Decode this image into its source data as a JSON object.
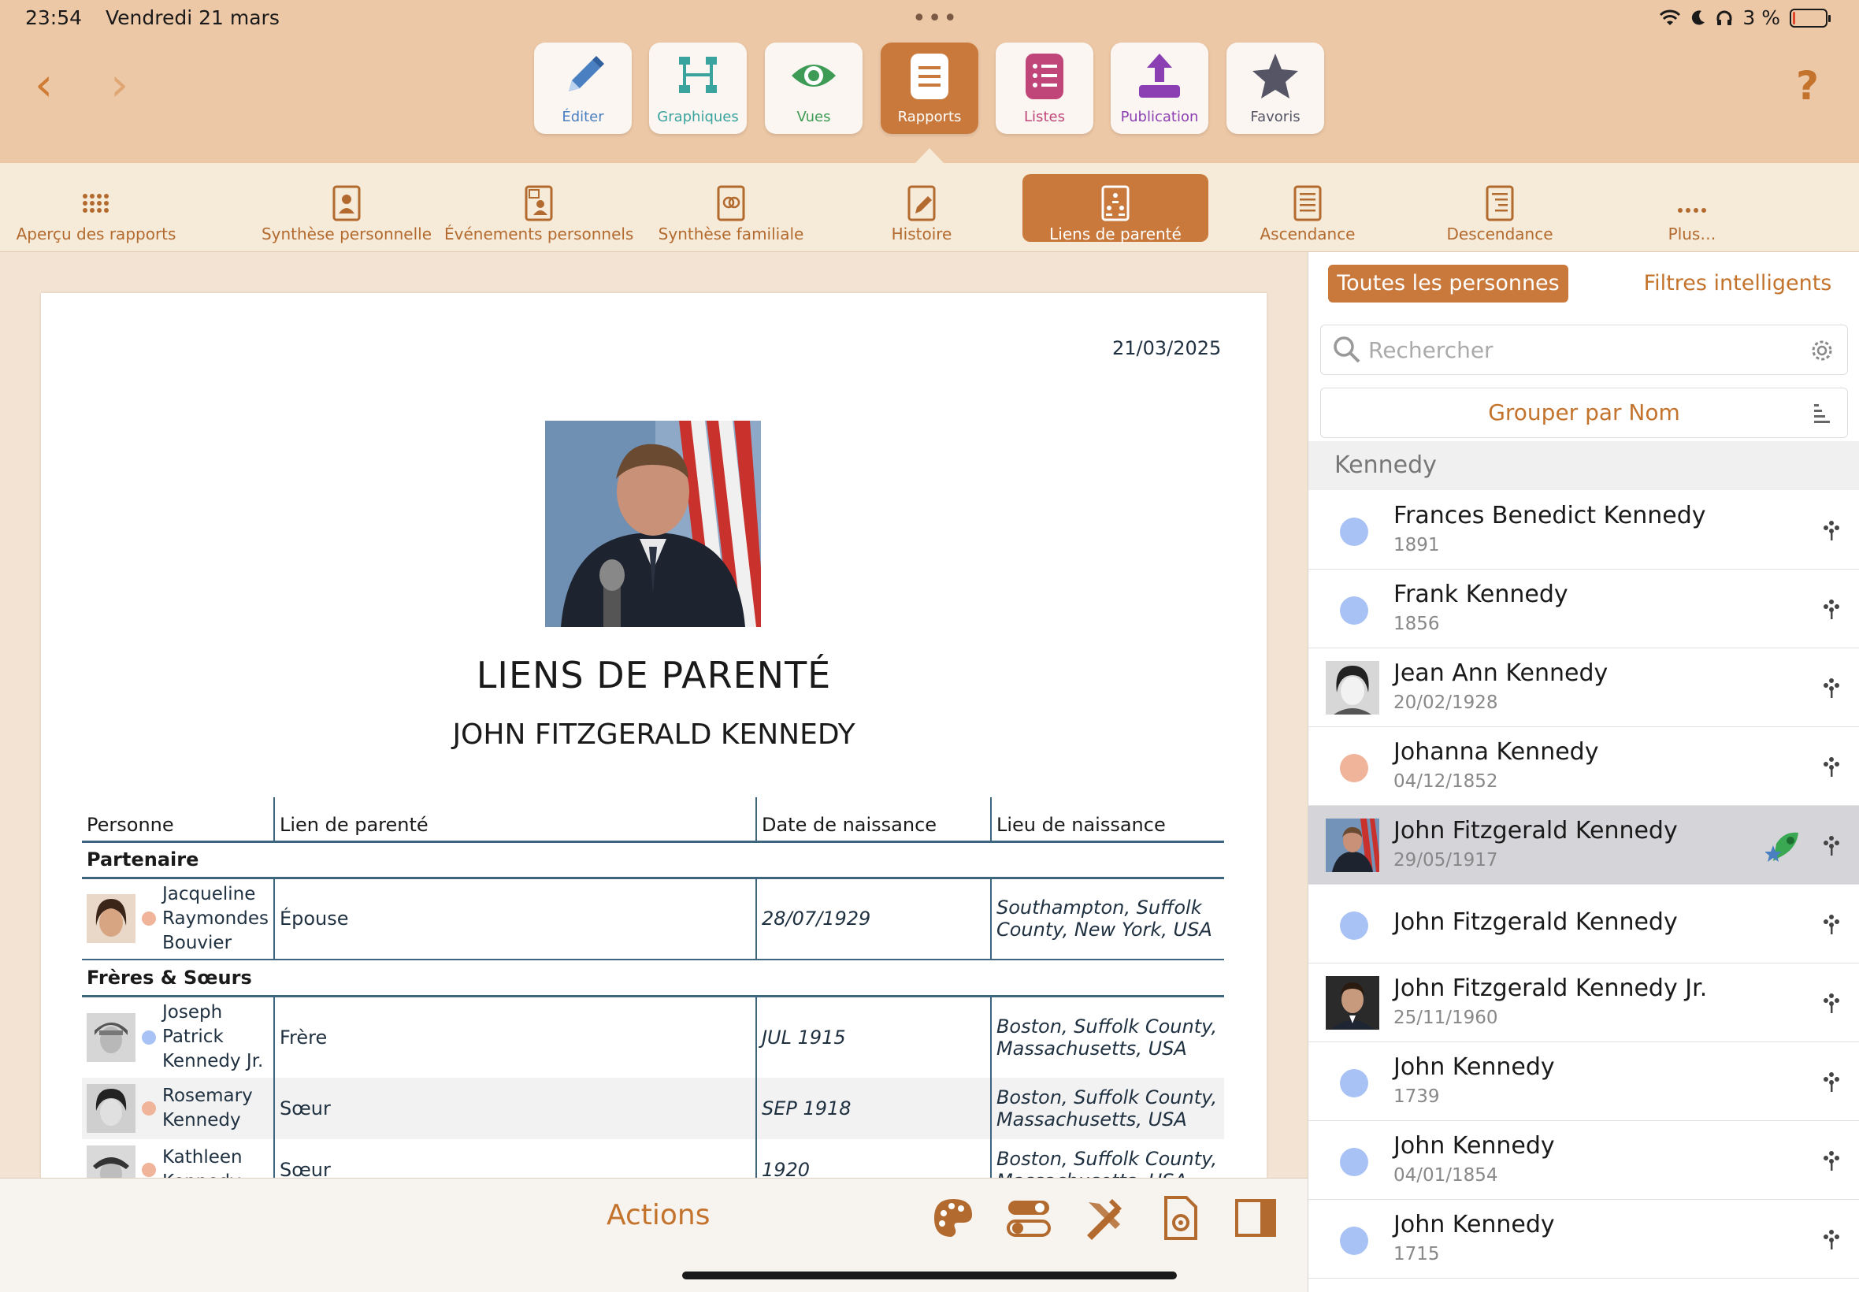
{
  "status": {
    "time": "23:54",
    "date": "Vendredi 21 mars",
    "battery": "3 %",
    "battery_level": 0.03
  },
  "toolbar": [
    {
      "label": "Éditer",
      "icon": "pencil-icon",
      "color": "#4a7fc1"
    },
    {
      "label": "Graphiques",
      "icon": "tree-chart-icon",
      "color": "#3aa39e"
    },
    {
      "label": "Vues",
      "icon": "eye-icon",
      "color": "#3d9b55"
    },
    {
      "label": "Rapports",
      "icon": "report-list-icon",
      "color": "#ffffff"
    },
    {
      "label": "Listes",
      "icon": "list-icon",
      "color": "#c0467a"
    },
    {
      "label": "Publication",
      "icon": "upload-icon",
      "color": "#8b3fb3"
    },
    {
      "label": "Favoris",
      "icon": "star-icon",
      "color": "#555566"
    }
  ],
  "report_tabs": [
    {
      "label": "Aperçu des rapports",
      "icon": "grid-icon"
    },
    {
      "label": "Synthèse personnelle",
      "icon": "person-report-icon"
    },
    {
      "label": "Événements personnels",
      "icon": "calendar-person-icon"
    },
    {
      "label": "Synthèse familiale",
      "icon": "family-report-icon"
    },
    {
      "label": "Histoire",
      "icon": "story-icon"
    },
    {
      "label": "Liens de parenté",
      "icon": "kinship-report-icon"
    },
    {
      "label": "Ascendance",
      "icon": "ancestry-report-icon"
    },
    {
      "label": "Descendance",
      "icon": "descendancy-report-icon"
    },
    {
      "label": "Plus…",
      "icon": "more-icon"
    }
  ],
  "report": {
    "date": "21/03/2025",
    "title": "LIENS DE PARENTÉ",
    "subtitle": "JOHN FITZGERALD KENNEDY",
    "columns": [
      "Personne",
      "Lien de parenté",
      "Date de naissance",
      "Lieu de naissance"
    ],
    "groups": [
      {
        "name": "Partenaire",
        "rows": [
          {
            "person": "Jacqueline Raymondes Bouvier",
            "relation": "Épouse",
            "birth_date": "28/07/1929",
            "birth_place": "Southampton, Suffolk County, New York, USA",
            "gender_color": "#f0b49a"
          }
        ]
      },
      {
        "name": "Frères & Sœurs",
        "rows": [
          {
            "person": "Joseph Patrick Kennedy Jr.",
            "relation": "Frère",
            "birth_date": "JUL 1915",
            "birth_place": "Boston, Suffolk County, Massachusetts, USA",
            "gender_color": "#a9c2f5"
          },
          {
            "person": "Rosemary Kennedy",
            "relation": "Sœur",
            "birth_date": "SEP 1918",
            "birth_place": "Boston, Suffolk County, Massachusetts, USA",
            "gender_color": "#f0b49a"
          },
          {
            "person": "Kathleen Kennedy",
            "relation": "Sœur",
            "birth_date": "1920",
            "birth_place": "Boston, Suffolk County, Massachusetts, USA",
            "gender_color": "#f0b49a"
          }
        ]
      }
    ]
  },
  "actionbar": {
    "actions_label": "Actions",
    "icons": [
      "palette-icon",
      "toggles-icon",
      "tools-icon",
      "page-settings-icon",
      "sidebar-toggle-icon"
    ]
  },
  "sidebar": {
    "segment_all": "Toutes les personnes",
    "segment_smart": "Filtres intelligents",
    "search_placeholder": "Rechercher",
    "group_by": "Grouper par Nom",
    "section": "Kennedy",
    "persons": [
      {
        "name": "Frances Benedict Kennedy",
        "date": "1891",
        "avatar": "dot",
        "color": "#a9c2f5"
      },
      {
        "name": "Frank Kennedy",
        "date": "1856",
        "avatar": "dot",
        "color": "#a9c2f5"
      },
      {
        "name": "Jean Ann Kennedy",
        "date": "20/02/1928",
        "avatar": "photo"
      },
      {
        "name": "Johanna Kennedy",
        "date": "04/12/1852",
        "avatar": "dot",
        "color": "#f0b49a"
      },
      {
        "name": "John Fitzgerald Kennedy",
        "date": "29/05/1917",
        "avatar": "photo",
        "selected": true
      },
      {
        "name": "John Fitzgerald Kennedy",
        "date": "",
        "avatar": "dot",
        "color": "#a9c2f5"
      },
      {
        "name": "John Fitzgerald Kennedy Jr.",
        "date": "25/11/1960",
        "avatar": "photo"
      },
      {
        "name": "John Kennedy",
        "date": "1739",
        "avatar": "dot",
        "color": "#a9c2f5"
      },
      {
        "name": "John Kennedy",
        "date": "04/01/1854",
        "avatar": "dot",
        "color": "#a9c2f5"
      },
      {
        "name": "John Kennedy",
        "date": "1715",
        "avatar": "dot",
        "color": "#a9c2f5"
      }
    ]
  },
  "colors": {
    "accent": "#c9793b",
    "toolbar_bg": "#edc8a6",
    "tabs_bg": "#f6ead9",
    "table_line": "#3d6580"
  }
}
